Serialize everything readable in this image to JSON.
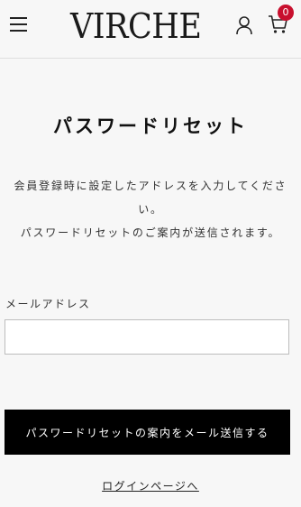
{
  "header": {
    "logo": "VIRCHE",
    "cart_count": "0",
    "icons": [
      "menu-icon",
      "user-icon",
      "cart-icon"
    ]
  },
  "main": {
    "title": "パスワードリセット",
    "description_line1": "会員登録時に設定したアドレスを入力してください。",
    "description_line2": "パスワードリセットのご案内が送信されます。",
    "email_label": "メールアドレス",
    "email_value": "",
    "submit_label": "パスワードリセットの案内をメール送信する",
    "login_link_label": "ログインページへ"
  },
  "colors": {
    "background": "#f7f7f7",
    "button": "#000000",
    "badge": "#c8102e"
  }
}
